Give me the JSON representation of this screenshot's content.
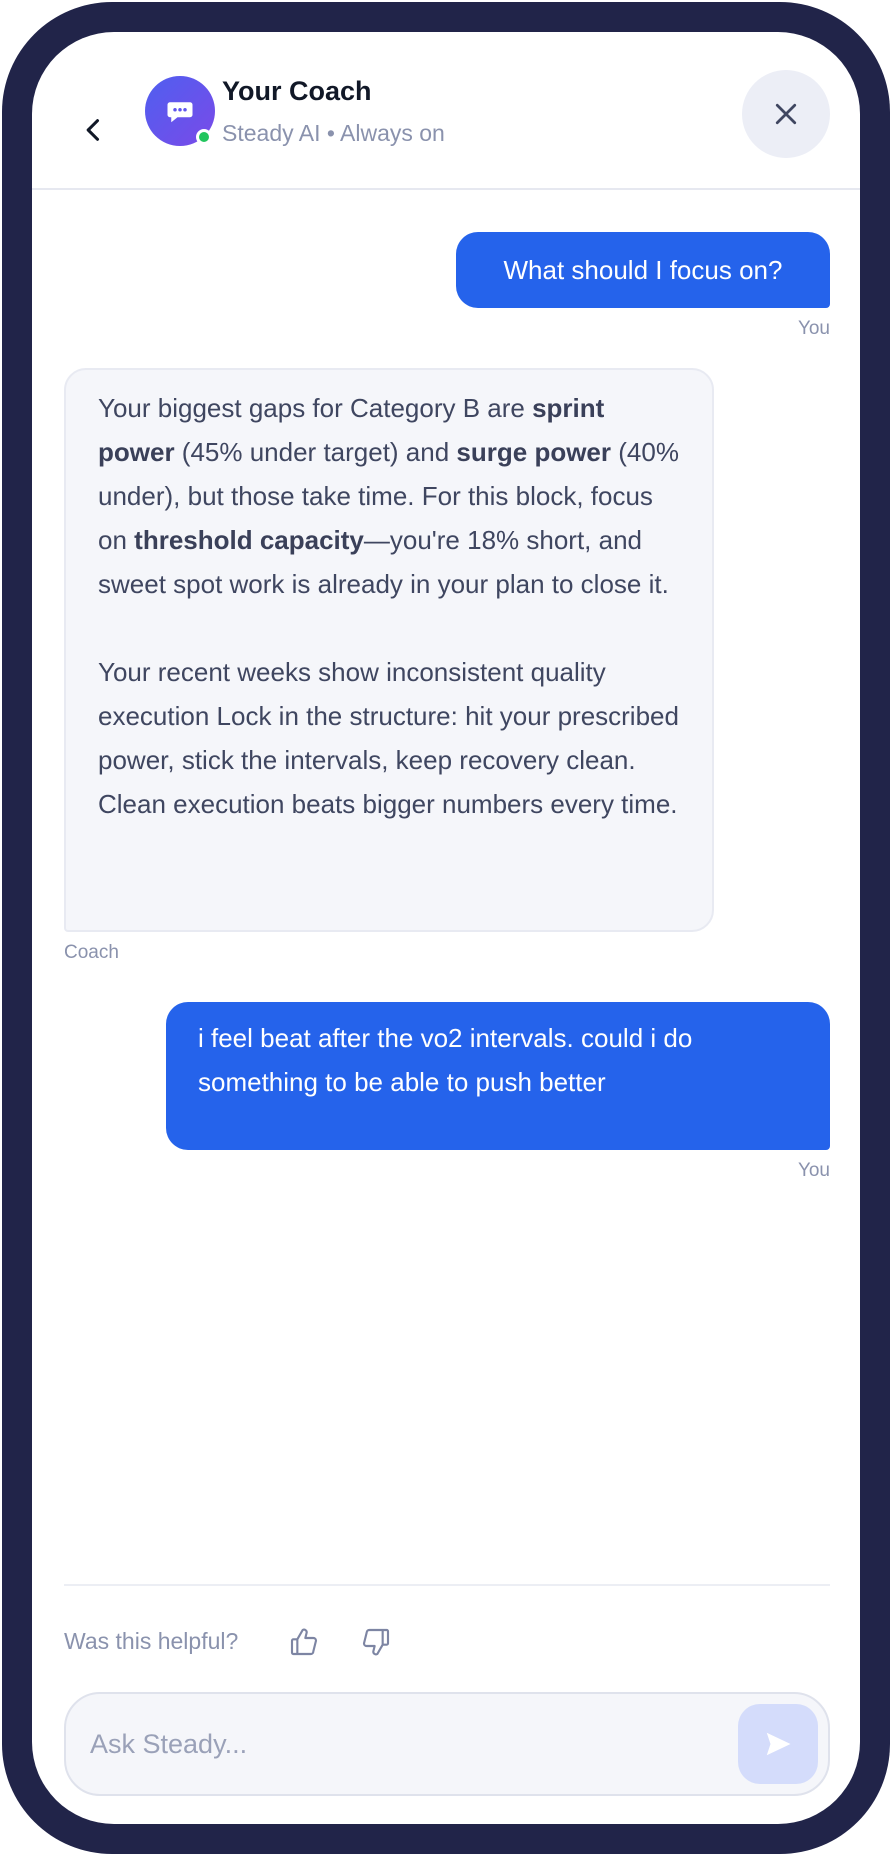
{
  "header": {
    "title": "Your Coach",
    "subtitle": "Steady AI • Always on",
    "back_icon": "chevron-left-icon",
    "avatar_icon": "chat-bubble-icon",
    "close_icon": "close-icon"
  },
  "messages": [
    {
      "sender": "You",
      "text": "What should I focus on?"
    },
    {
      "sender": "Coach",
      "p1": {
        "t1": "Your biggest gaps for Category B are ",
        "b1": "sprint power",
        "t2": " (45% under target) and ",
        "b2": "surge power",
        "t3": " (40% under), but those take time. For this block, focus on ",
        "b3": "threshold capacity",
        "t4": "—you're 18% short, and sweet spot work is already in your plan to close it."
      },
      "p2": "Your recent weeks show inconsistent quality execution Lock in the structure: hit your prescribed power, stick the intervals, keep recovery clean. Clean execution beats bigger numbers every time."
    },
    {
      "sender": "You",
      "text": "i feel beat after the vo2 intervals. could i do something to be able to push better"
    }
  ],
  "feedback": {
    "label": "Was this helpful?",
    "up_icon": "thumbs-up-icon",
    "down_icon": "thumbs-down-icon"
  },
  "composer": {
    "placeholder": "Ask Steady...",
    "value": "",
    "send_icon": "send-icon"
  },
  "colors": {
    "accent": "#2563eb",
    "frame": "#212449",
    "online": "#22c55e"
  }
}
